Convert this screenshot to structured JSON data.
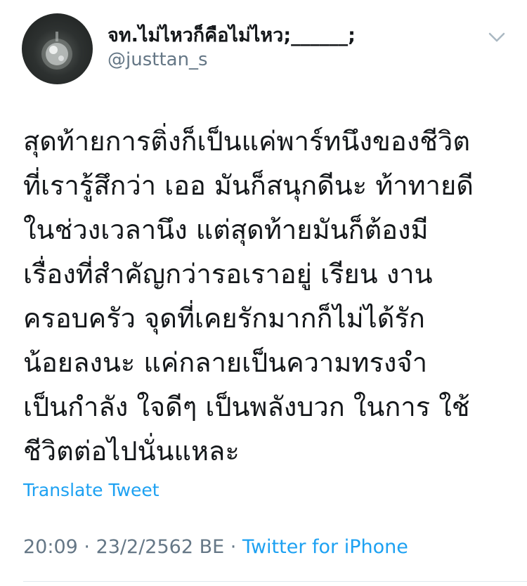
{
  "author": {
    "display_name": "จท.ไม่ไหวก็คือไม่ไหว;______;",
    "handle": "@justtan_s"
  },
  "tweet": {
    "lines": [
      "สุดท้ายการติ่งก็เป็นแค่พาร์ทนึงของชีวิต",
      "ที่เรารู้สึกว่า เออ มันก็สนุกดีนะ ท้าทายดี",
      "ในช่วงเวลานึง แต่สุดท้ายมันก็ต้องมี",
      "เรื่องที่สำคัญกว่ารอเราอยู่ เรียน งาน",
      "ครอบครัว จุดที่เคยรักมากก็ไม่ได้รัก",
      "น้อยลงนะ แค่กลายเป็นความทรงจำ",
      "เป็นกำลัง ใจดีๆ เป็นพลังบวก ในการ ใช้",
      "ชีวิตต่อไปนั่นแหละ"
    ],
    "translate_label": "Translate Tweet"
  },
  "meta": {
    "time": "20:09",
    "separator": " · ",
    "date": "23/2/2562 BE",
    "source": "Twitter for iPhone"
  },
  "icons": {
    "menu": "chevron-down-icon",
    "avatar": "avatar"
  },
  "colors": {
    "link_blue": "#1da1f2",
    "secondary_gray": "#657786",
    "text": "#14171a"
  }
}
